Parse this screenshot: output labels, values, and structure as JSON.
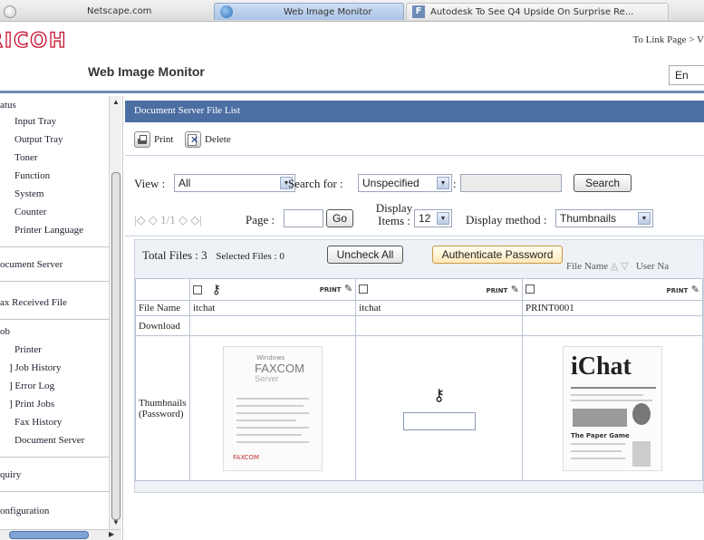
{
  "browser": {
    "tabs": [
      {
        "label": "Netscape.com"
      },
      {
        "label": "Web Image Monitor"
      },
      {
        "label": "Autodesk To See Q4 Upside On Surprise Re..."
      }
    ]
  },
  "header": {
    "logo": "RICOH",
    "top_link": "To Link Page >  V",
    "app_title": "Web Image Monitor",
    "language_value": "En"
  },
  "nav": {
    "items": [
      {
        "label": "atus"
      },
      {
        "label": "Input Tray"
      },
      {
        "label": "Output Tray"
      },
      {
        "label": "Toner"
      },
      {
        "label": "Function"
      },
      {
        "label": "System"
      },
      {
        "label": "Counter"
      },
      {
        "label": "Printer Language"
      },
      {
        "label": "ocument Server"
      },
      {
        "label": "ax Received File"
      },
      {
        "label": "ob"
      },
      {
        "label": "Printer"
      },
      {
        "label": "] Job History"
      },
      {
        "label": "] Error Log"
      },
      {
        "label": "] Print Jobs"
      },
      {
        "label": "Fax History"
      },
      {
        "label": "Document Server"
      },
      {
        "label": "quiry"
      },
      {
        "label": "onfiguration"
      }
    ]
  },
  "panel": {
    "title": "Document Server File List",
    "toolbar": {
      "print_label": "Print",
      "delete_label": "Delete"
    },
    "view_label": "View :",
    "view_value": "All",
    "search_label": "Search for :",
    "search_value": "Unspecified",
    "search_colon": ":",
    "search_button": "Search",
    "pager_text": "|◇ ◇ 1/1 ◇ ◇|",
    "page_label": "Page :",
    "go_button": "Go",
    "display_items_label": "Display Items :",
    "display_items_value": "12",
    "display_method_label": "Display method :",
    "display_method_value": "Thumbnails",
    "total_files": "Total Files : 3",
    "selected_files": "Selected Files : 0",
    "uncheck_all": "Uncheck All",
    "authenticate": "Authenticate Password",
    "sort_label": "File Name",
    "sort_indicator": "◬ ▽",
    "user_name_col": "User Na"
  },
  "table": {
    "row_labels": {
      "file_name": "File Name",
      "download": "Download",
      "thumbnails": "Thumbnails (Password)"
    },
    "print_icon_label": "PRINT",
    "files": [
      {
        "name": "itchat",
        "locked": true,
        "thumb_title_small": "Windows",
        "thumb_title": "FAXCOM",
        "thumb_subtitle": "Server",
        "thumb_footer": "FAXCOM"
      },
      {
        "name": "itchat",
        "locked": true
      },
      {
        "name": "PRINT0001",
        "locked": false,
        "thumb_title": "iChat",
        "thumb_caption": "The Paper Game"
      }
    ]
  }
}
